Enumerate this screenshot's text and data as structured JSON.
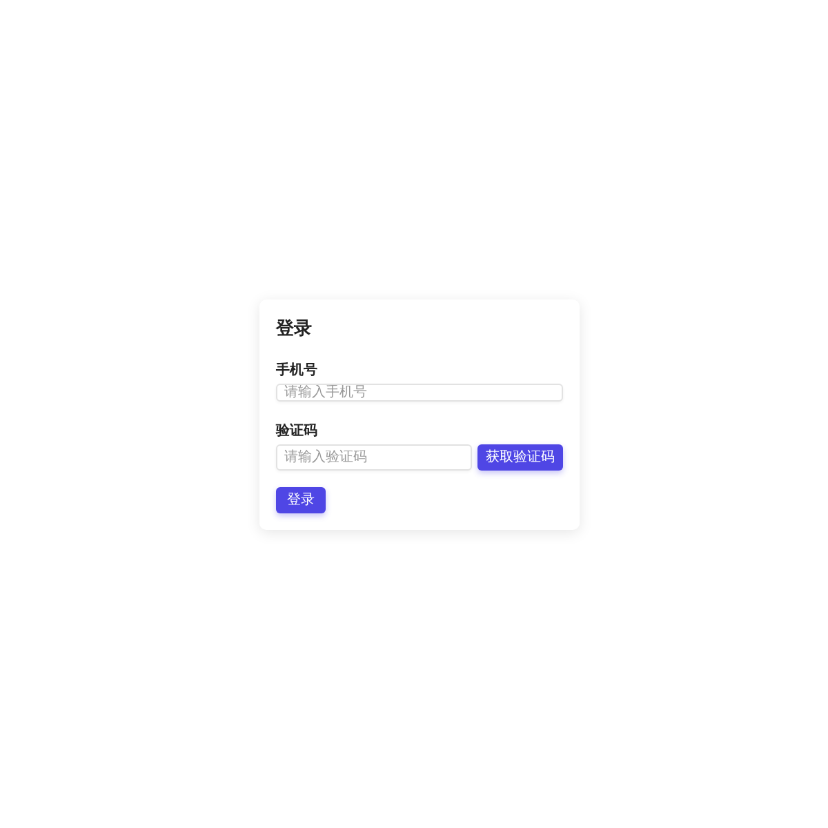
{
  "title": "登录",
  "phone": {
    "label": "手机号",
    "placeholder": "请输入手机号"
  },
  "code": {
    "label": "验证码",
    "placeholder": "请输入验证码",
    "button": "获取验证码"
  },
  "submit": "登录"
}
